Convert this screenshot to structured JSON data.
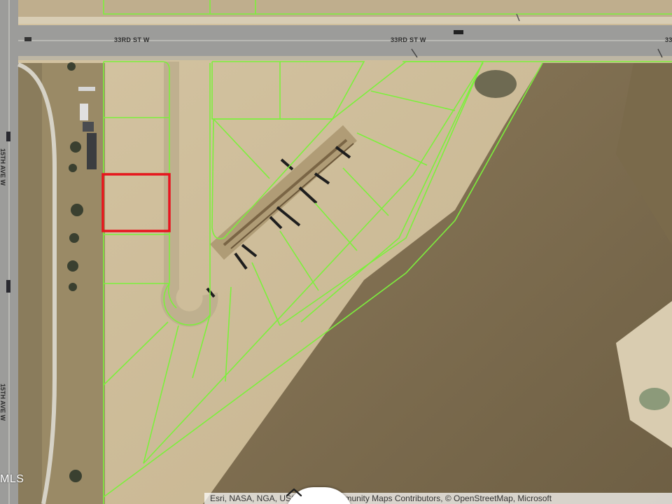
{
  "map": {
    "road_labels": {
      "top_left": "33RD ST W",
      "top_middle": "33RD ST W",
      "top_right_partial": "33",
      "left_upper": "15TH AVE W",
      "left_lower": "15TH AVE W"
    },
    "watermark": "MLS",
    "attribution": "Esri, NASA, NGA, USGS | Esri Community Maps Contributors, © OpenStreetMap, Microsoft",
    "colors": {
      "parcel_line": "#7cf03c",
      "highlight_parcel": "#e8141e",
      "road": "#9a9a98",
      "dirt": "#cdbd9c",
      "field": "#7c6a4c"
    },
    "controls": {
      "collapse_icon": "chevron-up-icon"
    }
  }
}
